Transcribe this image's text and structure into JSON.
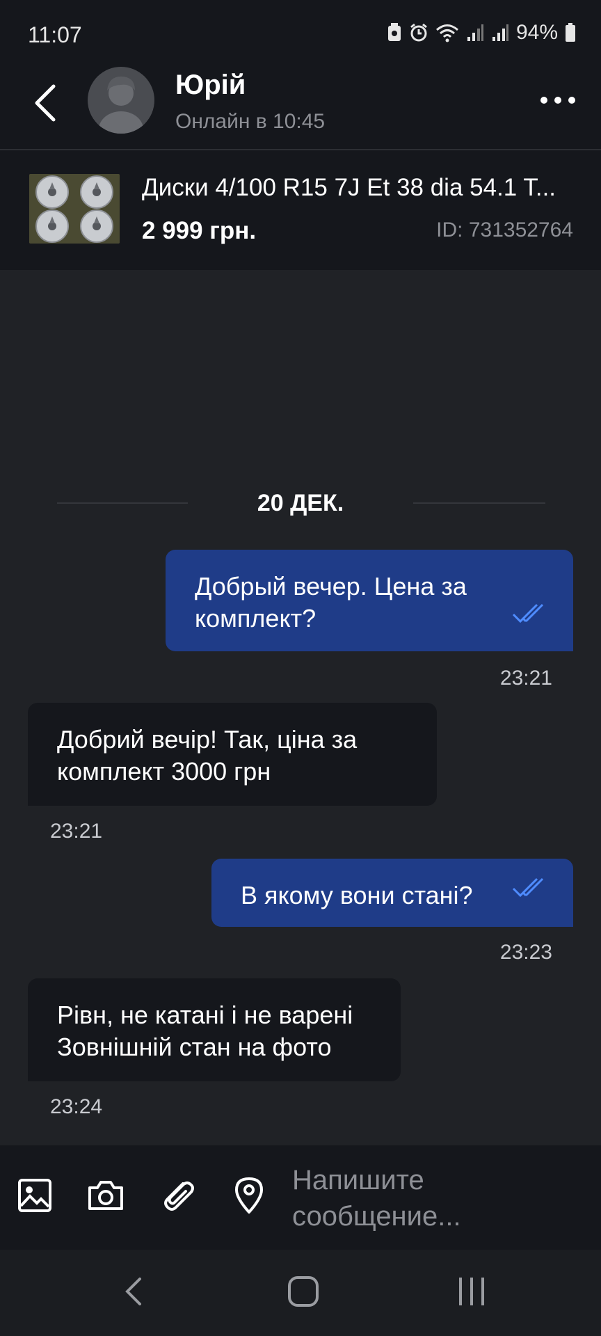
{
  "status_bar": {
    "time": "11:07",
    "battery": "94%",
    "icons": [
      "android-icon",
      "alarm-icon",
      "wifi-icon",
      "signal-icon",
      "signal-icon",
      "battery-icon"
    ]
  },
  "header": {
    "contact_name": "Юрій",
    "contact_status": "Онлайн в 10:45",
    "back_icon": "chevron-left-icon",
    "more_icon": "more-dots-icon"
  },
  "listing": {
    "title": "Диски 4/100 R15 7J Et 38 dia 54.1 T...",
    "price": "2 999 грн.",
    "id": "ID: 731352764"
  },
  "chat": {
    "date_label": "20 ДЕК.",
    "messages": [
      {
        "direction": "out",
        "line1": "Добрый вечер. Цена за",
        "line2": "комплект?",
        "time": "23:21"
      },
      {
        "direction": "in",
        "line1": "Добрий вечір! Так, ціна за",
        "line2": "комплект 3000 грн",
        "time": "23:21"
      },
      {
        "direction": "out",
        "line1": "В якому вони стані?",
        "time": "23:23"
      },
      {
        "direction": "in",
        "line1": "Рівн, не катані і не варені",
        "line2": "Зовнішній стан на фото",
        "time": "23:24"
      }
    ]
  },
  "composer": {
    "placeholder_line1": "Напишите",
    "placeholder_line2": "сообщение...",
    "icons": [
      "image-icon",
      "camera-icon",
      "paperclip-icon",
      "location-pin-icon"
    ]
  },
  "colors": {
    "background": "#202226",
    "bar": "#15171c",
    "outgoing_bubble": "#1f3c88",
    "incoming_bubble": "#15171c",
    "read_tick": "#4f8cff"
  }
}
